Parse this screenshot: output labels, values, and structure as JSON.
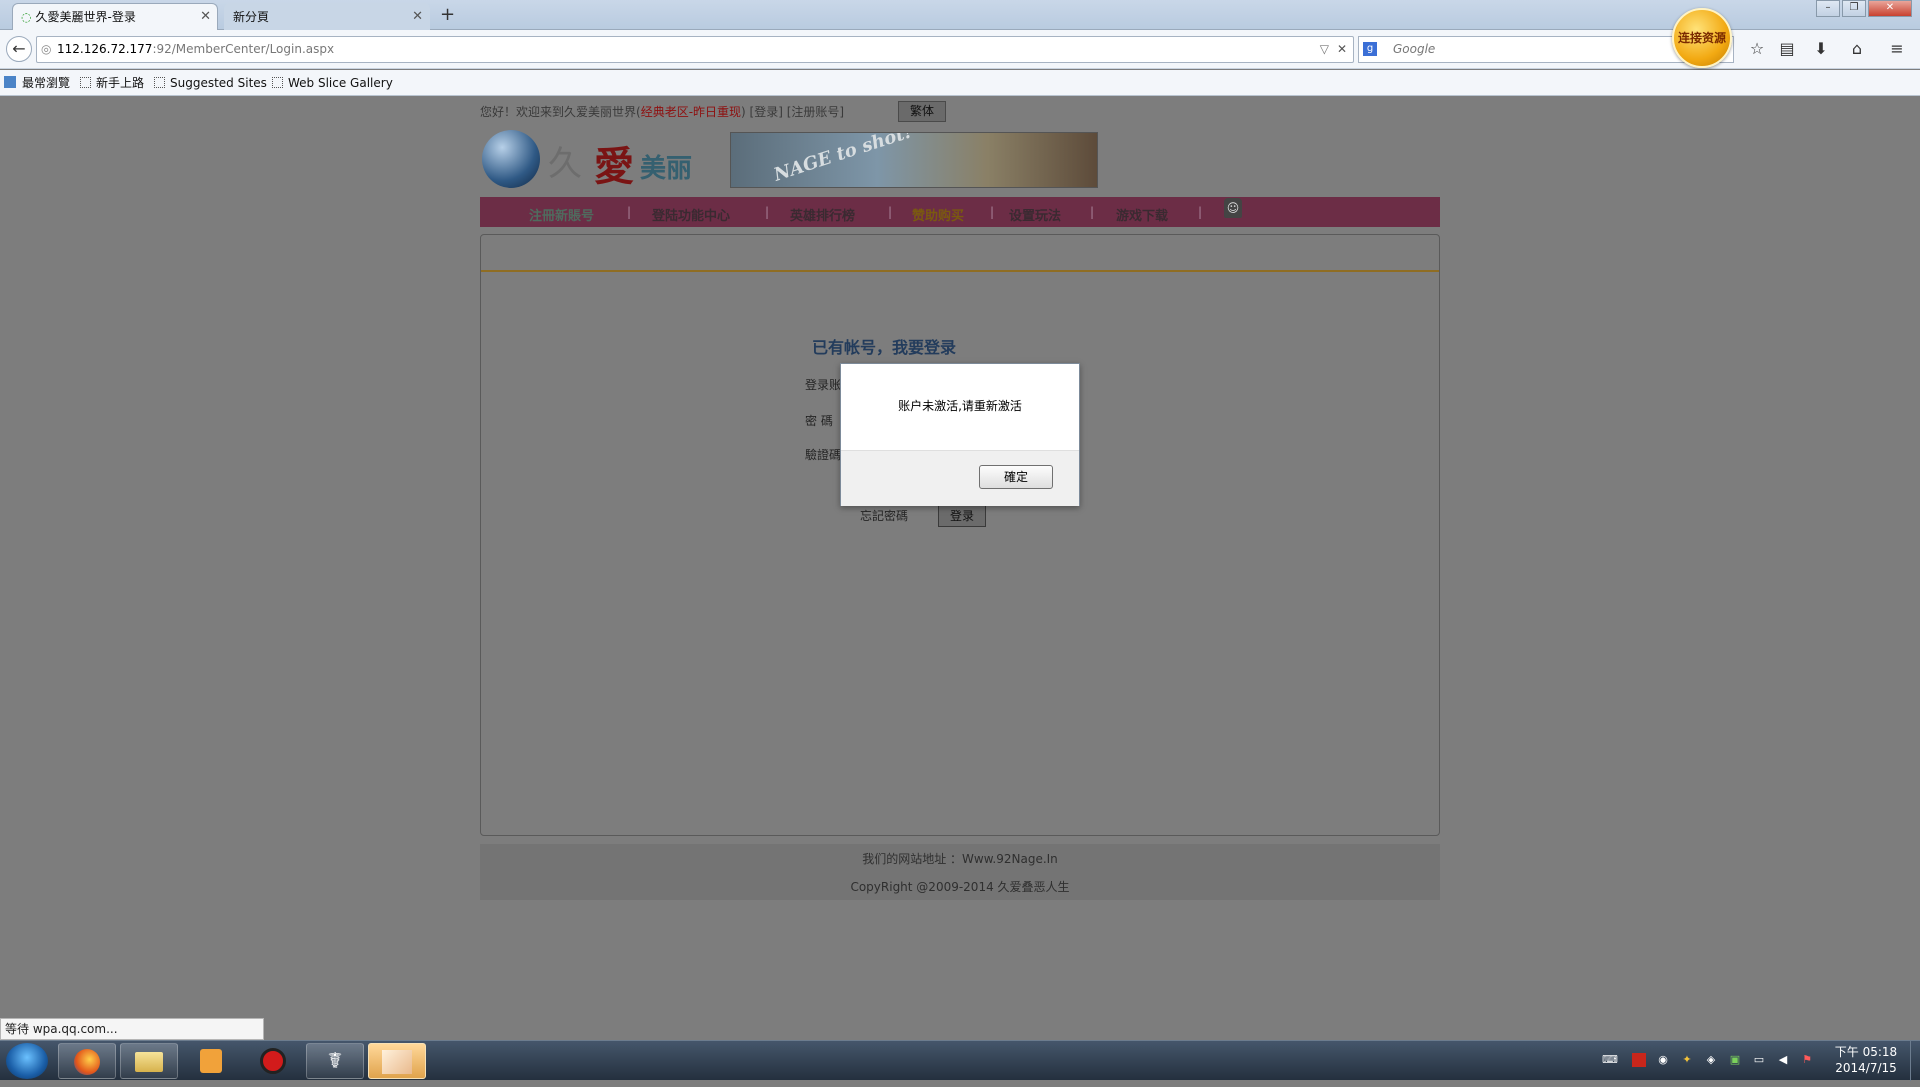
{
  "browser": {
    "tabs": [
      {
        "title": "久愛美麗世界-登录",
        "active": true
      },
      {
        "title": "新分頁",
        "active": false
      }
    ],
    "new_tab_symbol": "+",
    "url_host": "112.126.72.177",
    "url_path": ":92/MemberCenter/Login.aspx",
    "search_placeholder": "Google",
    "addon_badge": "连接资源",
    "bookmarks": [
      "最常瀏覽",
      "新手上路",
      "Suggested Sites",
      "Web Slice Gallery"
    ],
    "status_text": "等待 wpa.qq.com..."
  },
  "site": {
    "welcome_prefix": "您好！欢迎来到久爱美丽世界(",
    "welcome_highlight": "经典老区-昨日重现",
    "welcome_suffix": ")  [登录]  [注册账号]",
    "lang_button": "繁体",
    "logo_text_1": "久",
    "logo_text_2": "愛",
    "logo_text_3": "美丽",
    "banner_text": "NAGE to shot!",
    "menu": [
      "注冊新賬号",
      "登陆功能中心",
      "英雄排行榜",
      "赞助购买",
      "设置玩法",
      "游戏下载"
    ],
    "menu_separator": "|",
    "login_title": "已有帐号，我要登录",
    "field_labels": [
      "登录账",
      "密  碼",
      "驗證碼"
    ],
    "forgot_password": "忘記密碼",
    "login_button": "登录",
    "footer_line1": "我们的网站地址 ：Www.92Nage.In",
    "footer_line2": "CopyRight @2009-2014 久爱叠恶人生"
  },
  "dialog": {
    "message": "账户未激活,请重新激活",
    "ok_button": "確定"
  },
  "taskbar": {
    "clock_time": "下午 05:18",
    "clock_date": "2014/7/15"
  },
  "colors": {
    "menu_bar": "#c0377a",
    "overlay_dim": "#7d7d7d",
    "link_red": "#c00000"
  }
}
